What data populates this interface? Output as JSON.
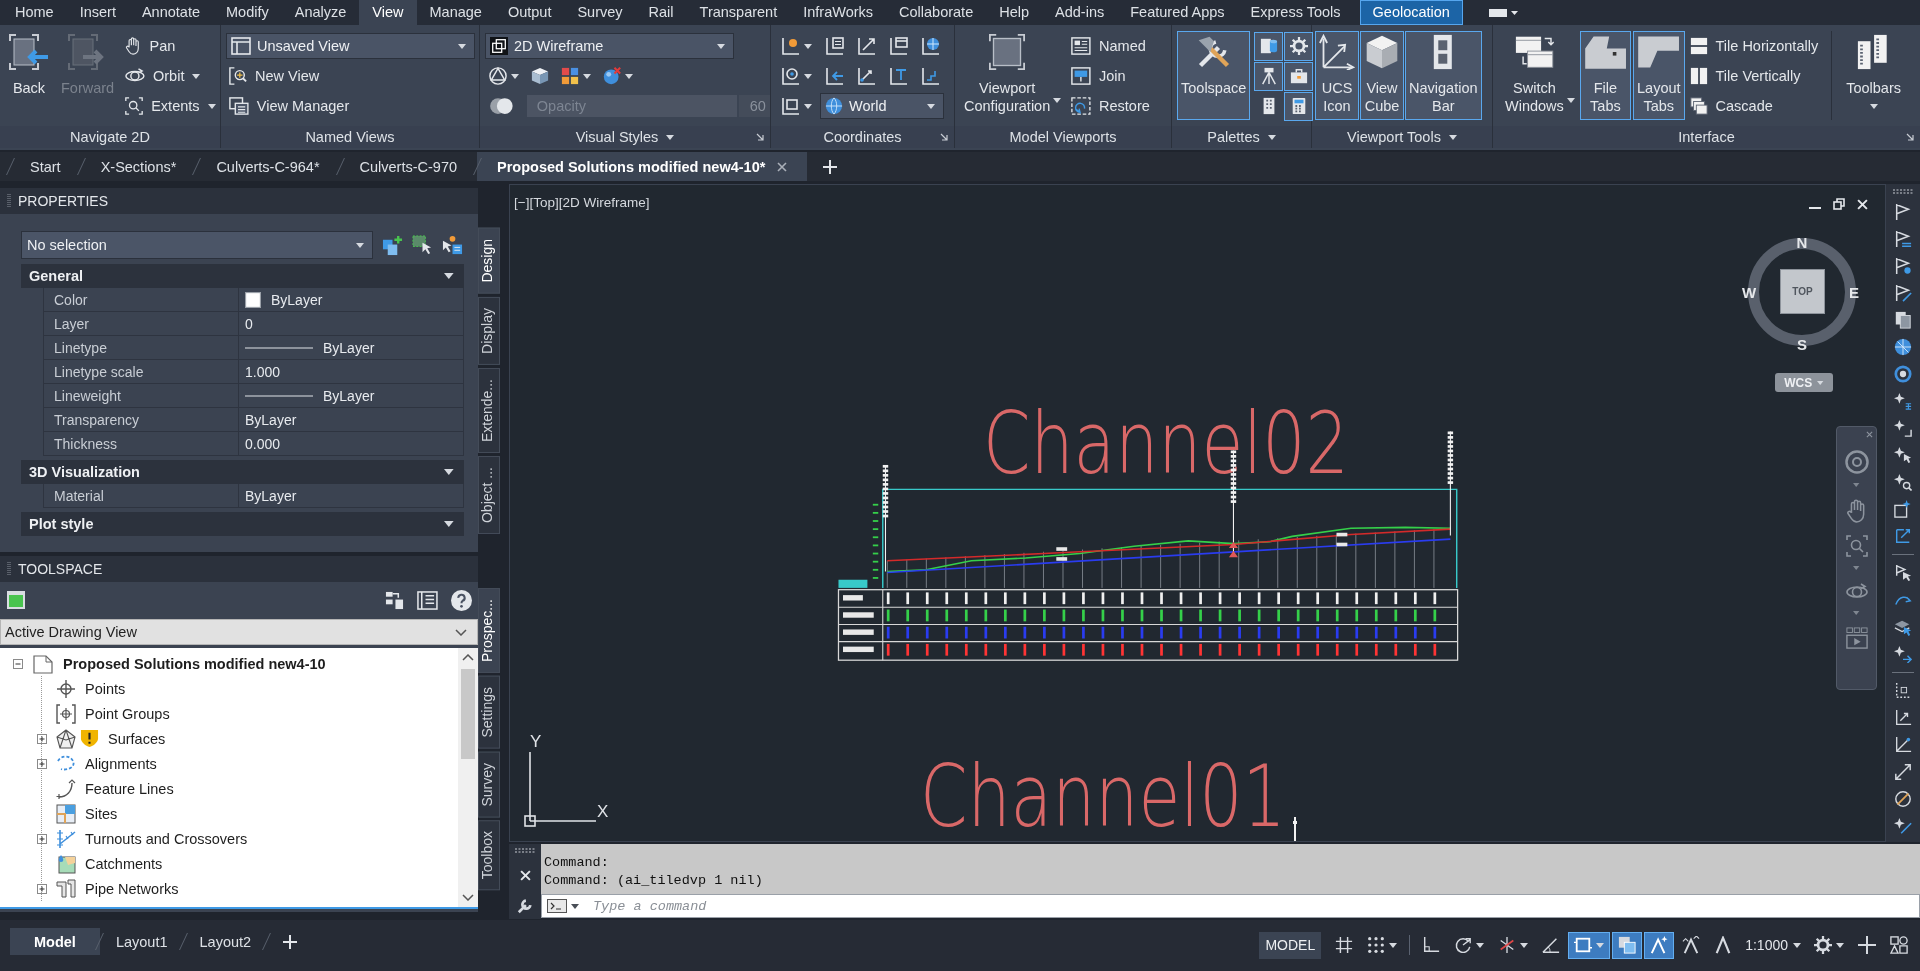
{
  "ribbon": {
    "tabs": [
      {
        "label": "Home",
        "selected": false,
        "contextual": false
      },
      {
        "label": "Insert",
        "selected": false,
        "contextual": false
      },
      {
        "label": "Annotate",
        "selected": false,
        "contextual": false
      },
      {
        "label": "Modify",
        "selected": false,
        "contextual": false
      },
      {
        "label": "Analyze",
        "selected": false,
        "contextual": false
      },
      {
        "label": "View",
        "selected": true,
        "contextual": false
      },
      {
        "label": "Manage",
        "selected": false,
        "contextual": false
      },
      {
        "label": "Output",
        "selected": false,
        "contextual": false
      },
      {
        "label": "Survey",
        "selected": false,
        "contextual": false
      },
      {
        "label": "Rail",
        "selected": false,
        "contextual": false
      },
      {
        "label": "Transparent",
        "selected": false,
        "contextual": false
      },
      {
        "label": "InfraWorks",
        "selected": false,
        "contextual": false
      },
      {
        "label": "Collaborate",
        "selected": false,
        "contextual": false
      },
      {
        "label": "Help",
        "selected": false,
        "contextual": false
      },
      {
        "label": "Add-ins",
        "selected": false,
        "contextual": false
      },
      {
        "label": "Featured Apps",
        "selected": false,
        "contextual": false
      },
      {
        "label": "Express Tools",
        "selected": false,
        "contextual": false
      },
      {
        "label": "Geolocation",
        "selected": false,
        "contextual": true
      }
    ],
    "panels": [
      {
        "title": "Navigate 2D",
        "menu": false,
        "launcher": false,
        "tools": [
          {
            "kind": "large",
            "label": "Back",
            "disabled": false,
            "active": false,
            "dropdown": false
          },
          {
            "kind": "large",
            "label": "Forward",
            "disabled": true,
            "active": false,
            "dropdown": false
          },
          {
            "kind": "stack",
            "rows": [
              {
                "controls": [
                  {
                    "kind": "button",
                    "label": "Pan",
                    "dropdown": false
                  }
                ]
              },
              {
                "controls": [
                  {
                    "kind": "button",
                    "label": "Orbit",
                    "dropdown": true
                  }
                ]
              },
              {
                "controls": [
                  {
                    "kind": "button",
                    "label": "Extents",
                    "dropdown": true
                  }
                ]
              }
            ]
          }
        ]
      },
      {
        "title": "Named Views",
        "menu": false,
        "launcher": false,
        "tools": [
          {
            "kind": "stack",
            "rows": [
              {
                "controls": [
                  {
                    "kind": "combo",
                    "value": "Unsaved View"
                  }
                ]
              },
              {
                "controls": [
                  {
                    "kind": "button",
                    "label": "New View",
                    "dropdown": false
                  }
                ]
              },
              {
                "controls": [
                  {
                    "kind": "button",
                    "label": "View Manager",
                    "dropdown": false
                  }
                ]
              }
            ]
          }
        ]
      },
      {
        "title": "Visual Styles",
        "menu": true,
        "launcher": true,
        "tools": [
          {
            "kind": "stack",
            "rows": [
              {
                "controls": [
                  {
                    "kind": "combo",
                    "value": "2D Wireframe"
                  }
                ]
              },
              {
                "controls": [
                  {
                    "kind": "icon",
                    "active": false,
                    "dropdown": true
                  },
                  {
                    "kind": "icon",
                    "active": false,
                    "dropdown": false
                  },
                  {
                    "kind": "icon",
                    "active": false,
                    "dropdown": true
                  },
                  {
                    "kind": "icon",
                    "active": false,
                    "dropdown": true
                  }
                ]
              },
              {
                "controls": [
                  {
                    "kind": "icon",
                    "active": false,
                    "dropdown": false
                  },
                  {
                    "kind": "slider",
                    "label": "Opacity",
                    "value": "60",
                    "disabled": true
                  }
                ]
              }
            ]
          }
        ]
      },
      {
        "title": "Coordinates",
        "menu": false,
        "launcher": true,
        "tools": [
          {
            "kind": "stack",
            "rows": [
              {
                "controls": [
                  {
                    "kind": "icon",
                    "active": false,
                    "dropdown": true
                  },
                  {
                    "kind": "icon",
                    "active": false,
                    "dropdown": false
                  },
                  {
                    "kind": "icon",
                    "active": false,
                    "dropdown": false
                  },
                  {
                    "kind": "icon",
                    "active": false,
                    "dropdown": false
                  },
                  {
                    "kind": "icon",
                    "active": false,
                    "dropdown": false
                  }
                ]
              },
              {
                "controls": [
                  {
                    "kind": "icon",
                    "active": false,
                    "dropdown": true
                  },
                  {
                    "kind": "icon",
                    "active": false,
                    "dropdown": false
                  },
                  {
                    "kind": "icon",
                    "active": false,
                    "dropdown": false
                  },
                  {
                    "kind": "icon",
                    "active": false,
                    "dropdown": false
                  },
                  {
                    "kind": "icon",
                    "active": false,
                    "dropdown": false
                  }
                ]
              },
              {
                "controls": [
                  {
                    "kind": "icon",
                    "active": false,
                    "dropdown": true
                  },
                  {
                    "kind": "combo",
                    "value": "World"
                  }
                ]
              }
            ]
          }
        ]
      },
      {
        "title": "Model Viewports",
        "menu": false,
        "launcher": false,
        "tools": [
          {
            "kind": "large",
            "label": "Viewport Configuration",
            "disabled": false,
            "active": false,
            "dropdown": true
          },
          {
            "kind": "stack",
            "rows": [
              {
                "controls": [
                  {
                    "kind": "button",
                    "label": "Named",
                    "dropdown": false
                  }
                ]
              },
              {
                "controls": [
                  {
                    "kind": "button",
                    "label": "Join",
                    "dropdown": false
                  }
                ]
              },
              {
                "controls": [
                  {
                    "kind": "button",
                    "label": "Restore",
                    "dropdown": false
                  }
                ]
              }
            ]
          }
        ]
      },
      {
        "title": "Palettes",
        "menu": true,
        "launcher": false,
        "tools": [
          {
            "kind": "large",
            "label": "Toolspace",
            "disabled": false,
            "active": true,
            "dropdown": false
          },
          {
            "kind": "stack",
            "rows": [
              {
                "controls": [
                  {
                    "kind": "icon",
                    "active": true,
                    "dropdown": false
                  },
                  {
                    "kind": "icon",
                    "active": true,
                    "dropdown": false
                  }
                ]
              },
              {
                "controls": [
                  {
                    "kind": "icon",
                    "active": true,
                    "dropdown": false
                  },
                  {
                    "kind": "icon",
                    "active": true,
                    "dropdown": false
                  }
                ]
              },
              {
                "controls": [
                  {
                    "kind": "icon",
                    "active": false,
                    "dropdown": false
                  },
                  {
                    "kind": "icon",
                    "active": true,
                    "dropdown": false
                  }
                ]
              }
            ]
          }
        ]
      },
      {
        "title": "Viewport Tools",
        "menu": true,
        "launcher": false,
        "tools": [
          {
            "kind": "large",
            "label": "UCS Icon",
            "disabled": false,
            "active": true,
            "dropdown": false
          },
          {
            "kind": "large",
            "label": "View Cube",
            "disabled": false,
            "active": true,
            "dropdown": false
          },
          {
            "kind": "large",
            "label": "Navigation Bar",
            "disabled": false,
            "active": true,
            "dropdown": false
          }
        ]
      },
      {
        "title": "Interface",
        "menu": false,
        "launcher": true,
        "tools": [
          {
            "kind": "large",
            "label": "Switch Windows",
            "disabled": false,
            "active": false,
            "dropdown": true
          },
          {
            "kind": "large",
            "label": "File Tabs",
            "disabled": false,
            "active": true,
            "dropdown": false
          },
          {
            "kind": "large",
            "label": "Layout Tabs",
            "disabled": false,
            "active": true,
            "dropdown": false
          },
          {
            "kind": "stack",
            "rows": [
              {
                "controls": [
                  {
                    "kind": "button",
                    "label": "Tile Horizontally",
                    "dropdown": false
                  }
                ]
              },
              {
                "controls": [
                  {
                    "kind": "button",
                    "label": "Tile Vertically",
                    "dropdown": false
                  }
                ]
              },
              {
                "controls": [
                  {
                    "kind": "button",
                    "label": "Cascade",
                    "dropdown": false
                  }
                ]
              }
            ]
          },
          {
            "kind": "separator"
          },
          {
            "kind": "large",
            "label": "Toolbars",
            "disabled": false,
            "active": false,
            "dropdown": true
          }
        ]
      }
    ]
  },
  "file_tabs": [
    {
      "label": "Start",
      "selected": false
    },
    {
      "label": "X-Sections*",
      "selected": false
    },
    {
      "label": "Culverts-C-964*",
      "selected": false
    },
    {
      "label": "Culverts-C-970",
      "selected": false
    },
    {
      "label": "Proposed Solutions modified new4-10*",
      "selected": true
    }
  ],
  "properties": {
    "title": "PROPERTIES",
    "selection": "No selection",
    "sections": [
      {
        "title": "General",
        "rows": [
          {
            "label": "Color",
            "value": "ByLayer",
            "kind": "swatch"
          },
          {
            "label": "Layer",
            "value": "0",
            "kind": "text"
          },
          {
            "label": "Linetype",
            "value": "ByLayer",
            "kind": "line"
          },
          {
            "label": "Linetype scale",
            "value": "1.000",
            "kind": "text"
          },
          {
            "label": "Lineweight",
            "value": "ByLayer",
            "kind": "line"
          },
          {
            "label": "Transparency",
            "value": "ByLayer",
            "kind": "text"
          },
          {
            "label": "Thickness",
            "value": "0.000",
            "kind": "text"
          }
        ]
      },
      {
        "title": "3D Visualization",
        "rows": [
          {
            "label": "Material",
            "value": "ByLayer",
            "kind": "text"
          }
        ]
      },
      {
        "title": "Plot style"
      }
    ],
    "side_tabs": [
      {
        "label": "Design",
        "selected": true
      },
      {
        "label": "Display",
        "selected": false
      },
      {
        "label": "Extende...",
        "selected": false
      },
      {
        "label": "Object ...",
        "selected": false
      }
    ]
  },
  "toolspace": {
    "title": "TOOLSPACE",
    "view": "Active Drawing View",
    "tree": {
      "label": "Proposed Solutions modified new4-10",
      "expanded": true,
      "warning": false,
      "children": [
        {
          "label": "Points",
          "warning": false
        },
        {
          "label": "Point Groups",
          "warning": false
        },
        {
          "label": "Surfaces",
          "expanded": false,
          "warning": true
        },
        {
          "label": "Alignments",
          "expanded": false,
          "warning": false
        },
        {
          "label": "Feature Lines",
          "warning": false
        },
        {
          "label": "Sites",
          "warning": false
        },
        {
          "label": "Turnouts and Crossovers",
          "expanded": false,
          "warning": false
        },
        {
          "label": "Catchments",
          "warning": false
        },
        {
          "label": "Pipe Networks",
          "expanded": false,
          "warning": false
        }
      ]
    },
    "side_tabs": [
      {
        "label": "Prospec...",
        "selected": true
      },
      {
        "label": "Settings",
        "selected": false
      },
      {
        "label": "Survey",
        "selected": false
      },
      {
        "label": "Toolbox",
        "selected": false
      }
    ]
  },
  "viewport": {
    "label": "[−][Top][2D Wireframe]",
    "drawing_texts": [
      {
        "text": "Channel02"
      },
      {
        "text": "Channel01"
      }
    ],
    "viewcube": {
      "north": "N",
      "east": "E",
      "south": "S",
      "west": "W",
      "face": "TOP",
      "ucs_menu": "WCS"
    },
    "ucs_axes": {
      "x": "X",
      "y": "Y"
    }
  },
  "command_line": {
    "history": [
      "Command:",
      "Command: (ai_tiledvp 1 nil)"
    ],
    "placeholder": "Type a command"
  },
  "layout_tabs": [
    {
      "label": "Model",
      "selected": true
    },
    {
      "label": "Layout1",
      "selected": false
    },
    {
      "label": "Layout2",
      "selected": false
    }
  ],
  "status_bar": {
    "space": "MODEL",
    "toggles": [
      {
        "on": false,
        "dropdown": false
      },
      {
        "on": false,
        "dropdown": true
      },
      {
        "on": false,
        "dropdown": false
      },
      {
        "on": false,
        "dropdown": true
      },
      {
        "on": false,
        "dropdown": true
      },
      {
        "on": false,
        "dropdown": false
      },
      {
        "on": true,
        "dropdown": true
      },
      {
        "on": true,
        "dropdown": false
      },
      {
        "on": true,
        "dropdown": false
      },
      {
        "on": false,
        "dropdown": false
      },
      {
        "on": false,
        "dropdown": false
      }
    ],
    "scale": "1:1000"
  }
}
